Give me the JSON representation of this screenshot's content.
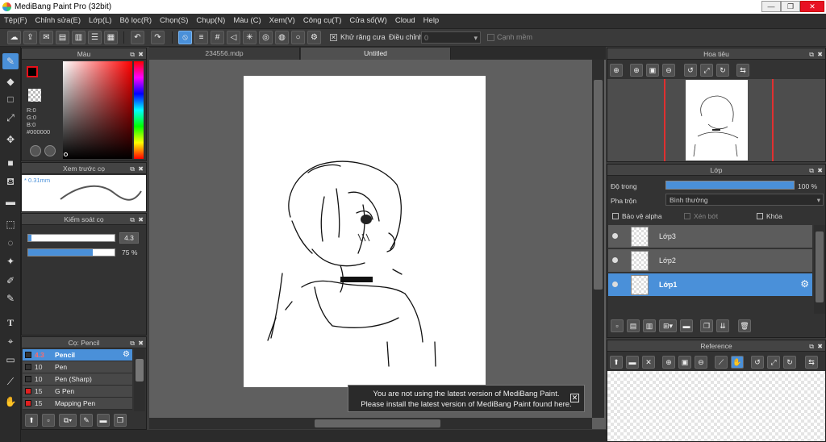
{
  "window": {
    "title": "MediBang Paint Pro (32bit)",
    "min": "—",
    "max": "❐",
    "close": "✕"
  },
  "menu": [
    "Tệp(F)",
    "Chỉnh sửa(E)",
    "Lớp(L)",
    "Bộ lọc(R)",
    "Chọn(S)",
    "Chụp(N)",
    "Màu (C)",
    "Xem(V)",
    "Công cụ(T)",
    "Cửa số(W)",
    "Cloud",
    "Help"
  ],
  "toolbar": {
    "antialias_label": "Khử răng cưa",
    "adjust_label": "Điều chỉnh",
    "adjust_value": "0",
    "sharp_label": "Cạnh mềm"
  },
  "color_panel": {
    "title": "Màu",
    "r": "R:0",
    "g": "G:0",
    "b": "B:0",
    "hex": "#000000",
    "primary": "#e8101a",
    "secondary": "#000000"
  },
  "preview_panel": {
    "title": "Xem trước cọ",
    "size": "0.31mm"
  },
  "brush_control": {
    "title": "Kiểm soát cọ",
    "size_value": "4.3",
    "opacity_value": "75 %",
    "size_fraction": 0.04,
    "opacity_fraction": 0.75
  },
  "brush_panel": {
    "title": "Cọ: Pencil",
    "items": [
      {
        "size": "4.3",
        "name": "Pencil",
        "color": "#333333",
        "selected": true
      },
      {
        "size": "10",
        "name": "Pen",
        "color": "#333333"
      },
      {
        "size": "10",
        "name": "Pen (Sharp)",
        "color": "#333333"
      },
      {
        "size": "15",
        "name": "G Pen",
        "color": "#e02020"
      },
      {
        "size": "15",
        "name": "Mapping Pen",
        "color": "#e02020"
      }
    ]
  },
  "tabs": [
    {
      "label": "234556.mdp"
    },
    {
      "label": "Untitled"
    }
  ],
  "navigator": {
    "title": "Hoa tiêu"
  },
  "layer_panel": {
    "title": "Lớp",
    "opacity_label": "Độ trong",
    "opacity_value": "100 %",
    "opacity_fraction": 1.0,
    "blend_label": "Pha trộn",
    "blend_value": "Bình thường",
    "protect_alpha": "Bảo vệ alpha",
    "clipping": "Xén bớt",
    "lock": "Khóa",
    "layers": [
      {
        "name": "Lớp3"
      },
      {
        "name": "Lớp2"
      },
      {
        "name": "Lớp1",
        "selected": true
      }
    ]
  },
  "reference_panel": {
    "title": "Reference"
  },
  "notice": {
    "line1": "You are not using the latest version of MediBang Paint.",
    "line2": "Please install the latest version of MediBang Paint found here."
  },
  "colors": {
    "accent": "#4a90d9"
  }
}
